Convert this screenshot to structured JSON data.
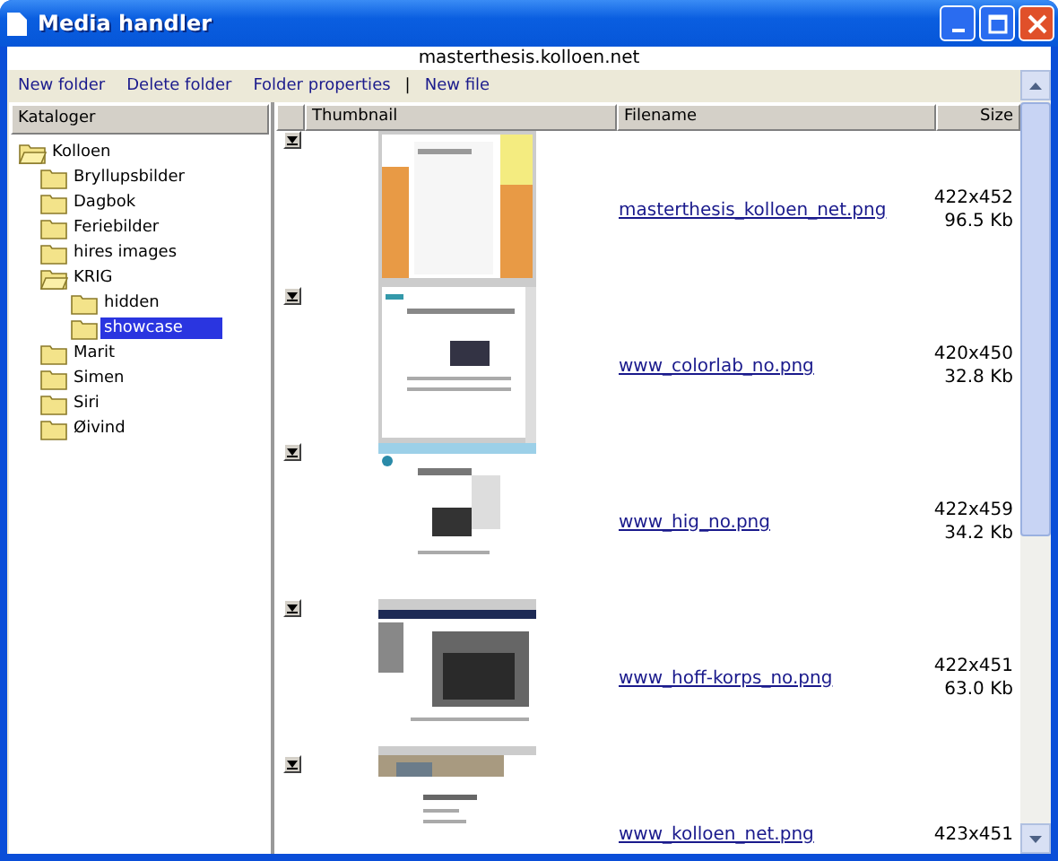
{
  "window": {
    "title": "Media handler",
    "address": "masterthesis.kolloen.net"
  },
  "toolbar": {
    "links": [
      {
        "label": "New folder"
      },
      {
        "label": "Delete folder"
      },
      {
        "label": "Folder properties"
      },
      {
        "label": "New file"
      }
    ],
    "separator": "|"
  },
  "tree": {
    "header": "Kataloger",
    "items": [
      {
        "label": "Kolloen",
        "selected": false,
        "children": [
          {
            "label": "Bryllupsbilder",
            "selected": false
          },
          {
            "label": "Dagbok",
            "selected": false
          },
          {
            "label": "Feriebilder",
            "selected": false
          },
          {
            "label": "hires images",
            "selected": false
          },
          {
            "label": "KRIG",
            "selected": false,
            "children": [
              {
                "label": "hidden",
                "selected": false
              },
              {
                "label": "showcase",
                "selected": true
              }
            ]
          },
          {
            "label": "Marit",
            "selected": false
          },
          {
            "label": "Simen",
            "selected": false
          },
          {
            "label": "Siri",
            "selected": false
          },
          {
            "label": "Øivind",
            "selected": false
          }
        ]
      }
    ]
  },
  "table": {
    "columns": [
      "Thumbnail",
      "Filename",
      "Size"
    ],
    "rows": [
      {
        "filename": "masterthesis_kolloen_net.png",
        "dimensions": "422x452",
        "size": "96.5 Kb"
      },
      {
        "filename": "www_colorlab_no.png",
        "dimensions": "420x450",
        "size": "32.8 Kb"
      },
      {
        "filename": "www_hig_no.png",
        "dimensions": "422x459",
        "size": "34.2 Kb"
      },
      {
        "filename": "www_hoff-korps_no.png",
        "dimensions": "422x451",
        "size": "63.0 Kb"
      },
      {
        "filename": "www_kolloen_net.png",
        "dimensions": "423x451"
      }
    ]
  }
}
